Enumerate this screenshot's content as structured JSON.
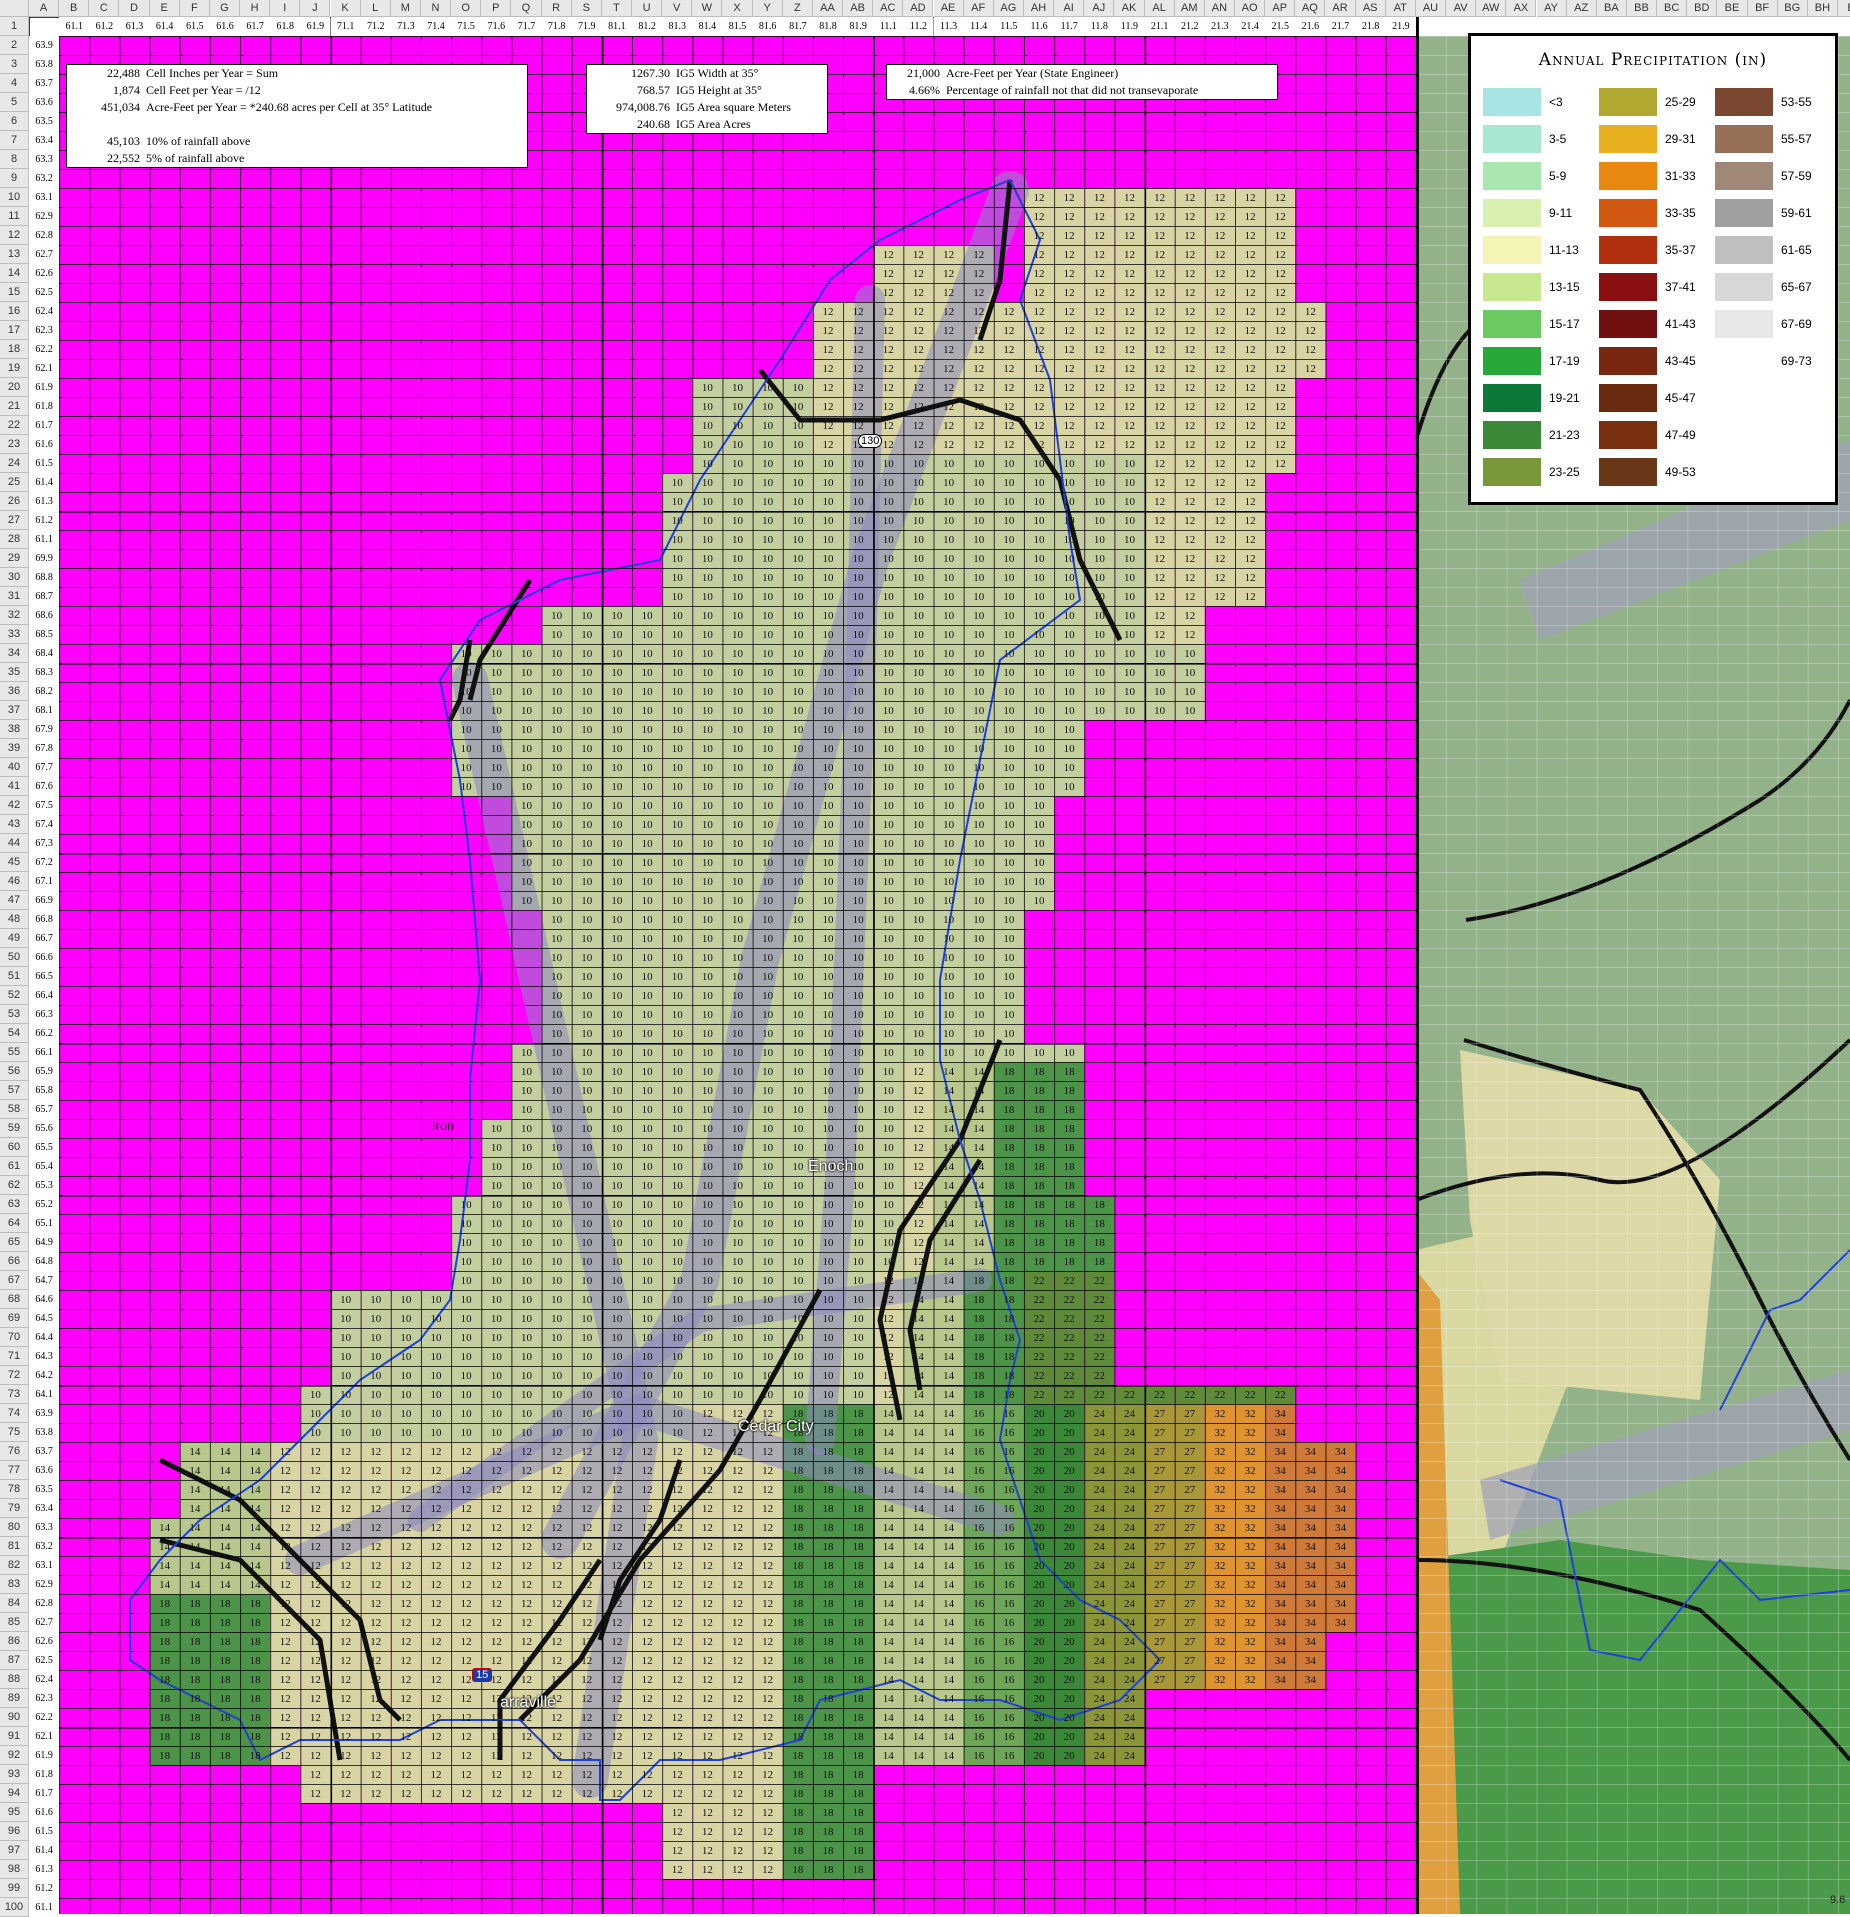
{
  "column_headers": [
    "A",
    "B",
    "C",
    "D",
    "E",
    "F",
    "G",
    "H",
    "I",
    "J",
    "K",
    "L",
    "M",
    "N",
    "O",
    "P",
    "Q",
    "R",
    "S",
    "T",
    "U",
    "V",
    "W",
    "X",
    "Y",
    "Z",
    "AA",
    "AB",
    "AC",
    "AD",
    "AE",
    "AF",
    "AG",
    "AH",
    "AI",
    "AJ",
    "AK",
    "AL",
    "AM",
    "AN",
    "AO",
    "AP",
    "AQ",
    "AR",
    "AS",
    "AT",
    "AU",
    "AV",
    "AW",
    "AX",
    "AY",
    "AZ",
    "BA",
    "BB",
    "BC",
    "BD",
    "BE",
    "BF",
    "BG",
    "BH",
    "BI"
  ],
  "row1_values": [
    "61.1",
    "61.2",
    "61.3",
    "61.4",
    "61.5",
    "61.6",
    "61.7",
    "61.8",
    "61.9",
    "71.1",
    "71.2",
    "71.3",
    "71.4",
    "71.5",
    "71.6",
    "71.7",
    "71.8",
    "71.9",
    "81.1",
    "81.2",
    "81.3",
    "81.4",
    "81.5",
    "81.6",
    "81.7",
    "81.8",
    "81.9",
    "11.1",
    "11.2",
    "11.3",
    "11.4",
    "11.5",
    "11.6",
    "11.7",
    "11.8",
    "11.9",
    "21.1",
    "21.2",
    "21.3",
    "21.4",
    "21.5",
    "21.6",
    "21.7",
    "21.8",
    "21.9"
  ],
  "columnA_values": [
    "63.9",
    "63.8",
    "63.7",
    "63.6",
    "63.5",
    "63.4",
    "63.3",
    "63.2",
    "63.1",
    "62.9",
    "62.8",
    "62.7",
    "62.6",
    "62.5",
    "62.4",
    "62.3",
    "62.2",
    "62.1",
    "61.9",
    "61.8",
    "61.7",
    "61.6",
    "61.5",
    "61.4",
    "61.3",
    "61.2",
    "61.1",
    "69.9",
    "68.8",
    "68.7",
    "68.6",
    "68.5",
    "68.4",
    "68.3",
    "68.2",
    "68.1",
    "67.9",
    "67.8",
    "67.7",
    "67.6",
    "67.5",
    "67.4",
    "67.3",
    "67.2",
    "67.1",
    "66.9",
    "66.8",
    "66.7",
    "66.6",
    "66.5",
    "66.4",
    "66.3",
    "66.2",
    "66.1",
    "65.9",
    "65.8",
    "65.7",
    "65.6",
    "65.5",
    "65.4",
    "65.3",
    "65.2",
    "65.1",
    "64.9",
    "64.8",
    "64.7",
    "64.6",
    "64.5",
    "64.4",
    "64.3",
    "64.2",
    "64.1",
    "63.9",
    "63.8",
    "63.7",
    "63.6",
    "63.5",
    "63.4",
    "63.3",
    "63.2",
    "63.1",
    "62.9",
    "62.8",
    "62.7",
    "62.6",
    "62.5",
    "62.4",
    "62.3",
    "62.2",
    "62.1",
    "61.9",
    "61.8",
    "61.7",
    "61.6",
    "61.5",
    "61.4",
    "61.3",
    "61.2",
    "61.1"
  ],
  "summary_block_1": [
    {
      "num": "22,488",
      "label": "Cell  Inches per Year = Sum"
    },
    {
      "num": "1,874",
      "label": "Cell Feet per Year = /12"
    },
    {
      "num": "451,034",
      "label": "Acre-Feet per Year = *240.68 acres per Cell at 35° Latitude"
    },
    {
      "num": "",
      "label": ""
    },
    {
      "num": "45,103",
      "label": "10% of rainfall above"
    },
    {
      "num": "22,552",
      "label": "5% of rainfall above"
    }
  ],
  "summary_block_2": [
    {
      "num": "1267.30",
      "label": "IG5 Width at 35°"
    },
    {
      "num": "768.57",
      "label": "IG5 Height at 35°"
    },
    {
      "num": "974,008.76",
      "label": "IG5 Area square Meters"
    },
    {
      "num": "240.68",
      "label": "IG5 Area Acres"
    }
  ],
  "summary_block_3": [
    {
      "num": "21,000",
      "label": "Acre-Feet per Year (State Engineer)"
    },
    {
      "num": "4.66%",
      "label": "Percentage  of rainfall not that did not transevaporate"
    }
  ],
  "map_labels": {
    "iron": "Iron",
    "enoch": "Enoch",
    "cedar_city": "Cedar City",
    "kanarraville": "arraville",
    "route_130": "130",
    "i15": "15",
    "scale_fragment": "9.6"
  },
  "legend": {
    "title": "Annual Precipitation (in)",
    "items": [
      {
        "label": "<3",
        "color": "#a8e4e4"
      },
      {
        "label": "3-5",
        "color": "#a8e8d0"
      },
      {
        "label": "5-9",
        "color": "#a8e8b0"
      },
      {
        "label": "9-11",
        "color": "#d8f0b0"
      },
      {
        "label": "11-13",
        "color": "#f4f4b4"
      },
      {
        "label": "13-15",
        "color": "#c8e890"
      },
      {
        "label": "15-17",
        "color": "#6cc860"
      },
      {
        "label": "17-19",
        "color": "#28a838"
      },
      {
        "label": "19-21",
        "color": "#0e7838"
      },
      {
        "label": "21-23",
        "color": "#3a8838"
      },
      {
        "label": "23-25",
        "color": "#78983a"
      },
      {
        "label": "25-29",
        "color": "#b0a830"
      },
      {
        "label": "29-31",
        "color": "#e8b020"
      },
      {
        "label": "31-33",
        "color": "#e88810"
      },
      {
        "label": "33-35",
        "color": "#d05810"
      },
      {
        "label": "35-37",
        "color": "#b03010"
      },
      {
        "label": "37-41",
        "color": "#881010"
      },
      {
        "label": "41-43",
        "color": "#701010"
      },
      {
        "label": "43-45",
        "color": "#782810"
      },
      {
        "label": "45-47",
        "color": "#6a2a10"
      },
      {
        "label": "47-49",
        "color": "#7a3010"
      },
      {
        "label": "49-53",
        "color": "#6a3818"
      },
      {
        "label": "53-55",
        "color": "#7a4830"
      },
      {
        "label": "55-57",
        "color": "#987058"
      },
      {
        "label": "57-59",
        "color": "#a08878"
      },
      {
        "label": "59-61",
        "color": "#a0a0a0"
      },
      {
        "label": "61-65",
        "color": "#c0c0c0"
      },
      {
        "label": "65-67",
        "color": "#d8d8d8"
      },
      {
        "label": "67-69",
        "color": "#e8e8e8"
      },
      {
        "label": "69-73",
        "color": "#ffffff"
      }
    ]
  },
  "colors": {
    "magenta_fill": "#ff00ff",
    "grid_line": "#000000",
    "header_bg": "#e8e8e8",
    "boundary_blue": "#2040d8"
  }
}
